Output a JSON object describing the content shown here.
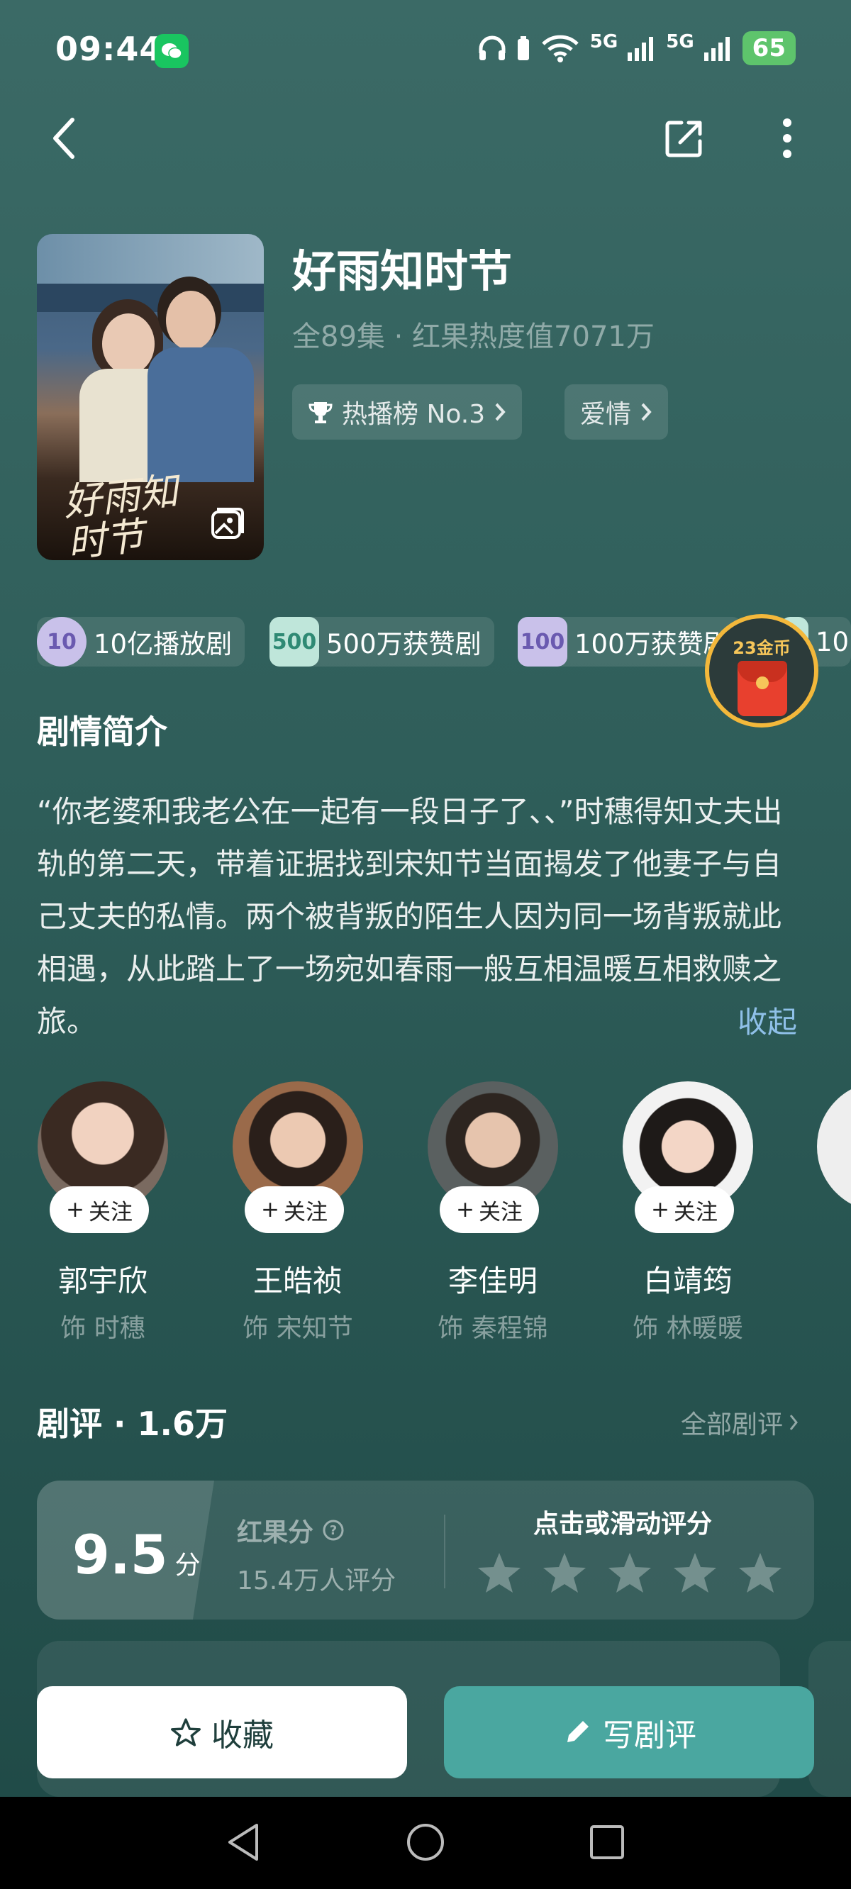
{
  "status_bar": {
    "time": "09:44",
    "signal_label_1": "5G",
    "signal_label_2": "5G",
    "battery": "65"
  },
  "drama": {
    "title": "好雨知时节",
    "meta": "全89集 · 红果热度值7071万",
    "chips": [
      {
        "label": "热播榜 No.3"
      },
      {
        "label": "爱情"
      }
    ],
    "poster_calligraphy": "好雨知时节"
  },
  "honors": [
    {
      "badge": "10",
      "label": "10亿播放剧",
      "color": "#a79bd6"
    },
    {
      "badge": "500",
      "label": "500万获赞剧",
      "color": "#76c9b4"
    },
    {
      "badge": "100",
      "label": "100万获赞剧",
      "color": "#9c8fd3"
    },
    {
      "badge": "10",
      "label": "10",
      "color": "#76c9b4"
    }
  ],
  "reward": {
    "label": "23金币"
  },
  "synopsis": {
    "heading": "剧情简介",
    "text": "“你老婆和我老公在一起有一段日子了、、”时穗得知丈夫出轨的第二天，带着证据找到宋知节当面揭发了他妻子与自己丈夫的私情。两个被背叛的陌生人因为同一场背叛就此相遇，从此踏上了一场宛如春雨一般互相温暖互相救赎之旅。",
    "collapse": "收起"
  },
  "cast": [
    {
      "name": "郭宇欣",
      "role": "饰 时穗",
      "follow": "关注"
    },
    {
      "name": "王皓祯",
      "role": "饰 宋知节",
      "follow": "关注"
    },
    {
      "name": "李佳明",
      "role": "饰 秦程锦",
      "follow": "关注"
    },
    {
      "name": "白靖筠",
      "role": "饰 林暖暖",
      "follow": "关注"
    }
  ],
  "reviews": {
    "heading": "剧评 · 1.6万",
    "all_link": "全部剧评",
    "score": "9.5",
    "score_unit": "分",
    "score_label": "红果分",
    "raters": "15.4万人评分",
    "rate_prompt": "点击或滑动评分",
    "stars": 5
  },
  "actions": {
    "collect": "收藏",
    "write_review": "写剧评"
  },
  "colors": {
    "accent": "#4aa7a0",
    "bg": "#2f5e5a",
    "link": "#8fc0e8"
  }
}
